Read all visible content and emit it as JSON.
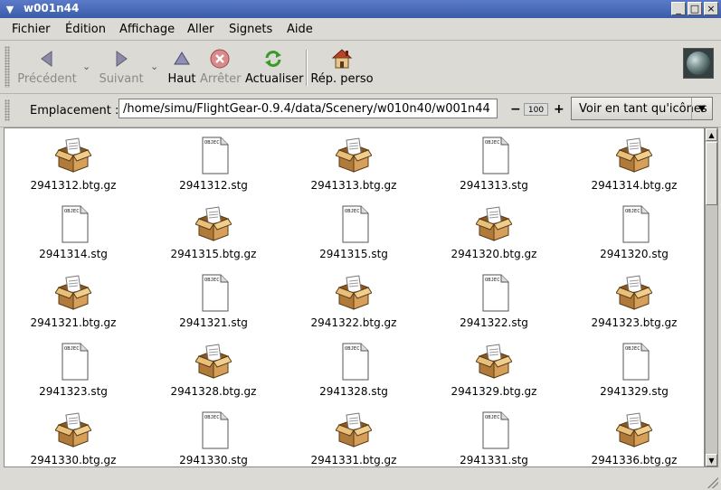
{
  "window": {
    "title": "w001n44"
  },
  "menu": {
    "items": [
      "Fichier",
      "Édition",
      "Affichage",
      "Aller",
      "Signets",
      "Aide"
    ]
  },
  "toolbar": {
    "back": "Précédent",
    "forward": "Suivant",
    "up": "Haut",
    "stop": "Arrêter",
    "reload": "Actualiser",
    "home": "Rép. perso"
  },
  "location": {
    "label": "Emplacement :",
    "path": "/home/simu/FlightGear-0.9.4/data/Scenery/w010n40/w001n44",
    "zoom": "100",
    "view_mode": "Voir en tant qu'icônes"
  },
  "icons": {
    "doc_label": "OBJEC"
  },
  "files": [
    {
      "name": "2941312.btg.gz",
      "type": "package"
    },
    {
      "name": "2941312.stg",
      "type": "document"
    },
    {
      "name": "2941313.btg.gz",
      "type": "package"
    },
    {
      "name": "2941313.stg",
      "type": "document"
    },
    {
      "name": "2941314.btg.gz",
      "type": "package"
    },
    {
      "name": "2941314.stg",
      "type": "document"
    },
    {
      "name": "2941315.btg.gz",
      "type": "package"
    },
    {
      "name": "2941315.stg",
      "type": "document"
    },
    {
      "name": "2941320.btg.gz",
      "type": "package"
    },
    {
      "name": "2941320.stg",
      "type": "document"
    },
    {
      "name": "2941321.btg.gz",
      "type": "package"
    },
    {
      "name": "2941321.stg",
      "type": "document"
    },
    {
      "name": "2941322.btg.gz",
      "type": "package"
    },
    {
      "name": "2941322.stg",
      "type": "document"
    },
    {
      "name": "2941323.btg.gz",
      "type": "package"
    },
    {
      "name": "2941323.stg",
      "type": "document"
    },
    {
      "name": "2941328.btg.gz",
      "type": "package"
    },
    {
      "name": "2941328.stg",
      "type": "document"
    },
    {
      "name": "2941329.btg.gz",
      "type": "package"
    },
    {
      "name": "2941329.stg",
      "type": "document"
    },
    {
      "name": "2941330.btg.gz",
      "type": "package"
    },
    {
      "name": "2941330.stg",
      "type": "document"
    },
    {
      "name": "2941331.btg.gz",
      "type": "package"
    },
    {
      "name": "2941331.stg",
      "type": "document"
    },
    {
      "name": "2941336.btg.gz",
      "type": "package"
    }
  ]
}
